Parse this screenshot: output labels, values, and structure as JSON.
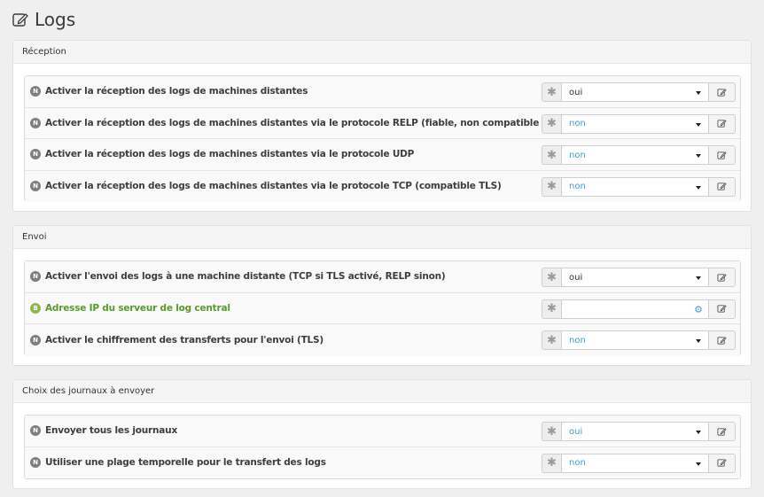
{
  "page": {
    "title": "Logs"
  },
  "sections": [
    {
      "title": "Réception",
      "rows": [
        {
          "badge": "N",
          "label": "Activer la réception des logs de machines distantes",
          "value": "oui",
          "kind": "select"
        },
        {
          "badge": "N",
          "label": "Activer la réception des logs de machines distantes via le protocole RELP (fiable, non compatible TLS)",
          "value": "non",
          "kind": "select"
        },
        {
          "badge": "N",
          "label": "Activer la réception des logs de machines distantes via le protocole UDP",
          "value": "non",
          "kind": "select"
        },
        {
          "badge": "N",
          "label": "Activer la réception des logs de machines distantes via le protocole TCP (compatible TLS)",
          "value": "non",
          "kind": "select"
        }
      ]
    },
    {
      "title": "Envoi",
      "rows": [
        {
          "badge": "N",
          "label": "Activer l'envoi des logs à une machine distante (TCP si TLS activé, RELP sinon)",
          "value": "oui",
          "kind": "select"
        },
        {
          "badge": "B",
          "label": "Adresse IP du serveur de log central",
          "value": "",
          "kind": "input"
        },
        {
          "badge": "N",
          "label": "Activer le chiffrement des transferts pour l'envoi (TLS)",
          "value": "non",
          "kind": "select"
        }
      ]
    },
    {
      "title": "Choix des journaux à envoyer",
      "rows": [
        {
          "badge": "N",
          "label": "Envoyer tous les journaux",
          "value": "oui",
          "kind": "select"
        },
        {
          "badge": "N",
          "label": "Utiliser une plage temporelle pour le transfert des logs",
          "value": "non",
          "kind": "select"
        }
      ]
    }
  ],
  "colors": {
    "accent_blue": "#3e9ddb",
    "basic_green": "#5b9a2e",
    "badge_grey": "#7f7f7f"
  },
  "icons": {
    "title": "edit-icon",
    "default": "asterisk-icon",
    "edit": "pencil-icon",
    "gear": "gears-icon",
    "caret": "caret-down-icon"
  }
}
